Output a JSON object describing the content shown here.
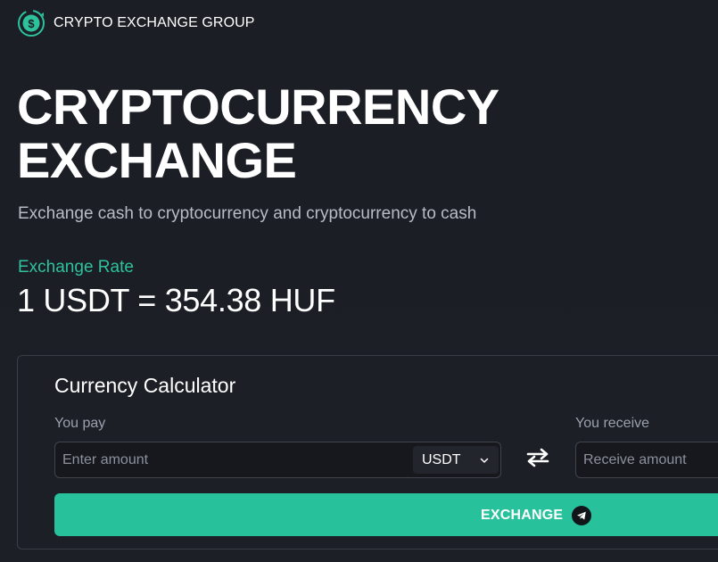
{
  "header": {
    "brand": "CRYPTO EXCHANGE GROUP",
    "logo_icon": "dollar-coin-cycle-icon"
  },
  "hero": {
    "title_line1": "CRYPTOCURRENCY",
    "title_line2": "EXCHANGE",
    "subtitle": "Exchange cash to cryptocurrency and cryptocurrency to cash"
  },
  "rate": {
    "label": "Exchange Rate",
    "value": "1 USDT = 354.38 HUF"
  },
  "calculator": {
    "title": "Currency Calculator",
    "pay_label": "You pay",
    "pay_value": "",
    "pay_placeholder": "Enter amount",
    "pay_currency": "USDT",
    "receive_label": "You receive",
    "receive_value": "",
    "receive_placeholder": "Receive amount",
    "swap_icon": "swap-arrows-icon",
    "exchange_label": "EXCHANGE",
    "exchange_icon": "telegram-icon"
  },
  "colors": {
    "background": "#1b1e24",
    "accent": "#27c29b",
    "accent_text": "#2ec29a",
    "muted_text": "#b8bcc6",
    "border": "#3a3e47"
  }
}
